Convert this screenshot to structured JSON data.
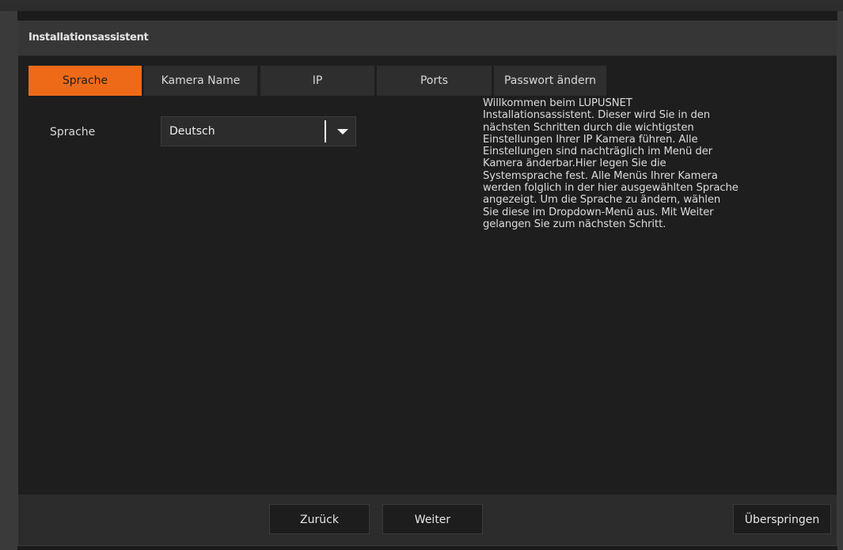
{
  "dialog": {
    "title": "Installationsassistent"
  },
  "tabs": [
    {
      "label": "Sprache",
      "active": true
    },
    {
      "label": "Kamera Name",
      "active": false
    },
    {
      "label": "IP",
      "active": false
    },
    {
      "label": "Ports",
      "active": false
    },
    {
      "label": "Passwort ändern",
      "active": false
    }
  ],
  "language_field": {
    "label": "Sprache",
    "selected": "Deutsch",
    "dropdown_icon": "caret-down-icon"
  },
  "help_text": "Willkommen beim LUPUSNET\nInstallationsassistent. Dieser wird Sie in den\nnächsten Schritten durch die wichtigsten\nEinstellungen Ihrer IP Kamera führen. Alle\nEinstellungen sind nachträglich im Menü der\nKamera änderbar.Hier legen Sie die\nSystemsprache fest. Alle Menüs Ihrer Kamera\nwerden folglich in der hier ausgewählten Sprache\nangezeigt. Um die Sprache zu ändern, wählen\nSie diese im Dropdown-Menü aus. Mit Weiter\ngelangen Sie zum nächsten Schritt.",
  "footer": {
    "back_label": "Zurück",
    "next_label": "Weiter",
    "skip_label": "Überspringen"
  },
  "colors": {
    "accent": "#ee6a18",
    "background": "#1e1e1e",
    "titlebar": "#363636",
    "footer": "#2c2c2c"
  }
}
